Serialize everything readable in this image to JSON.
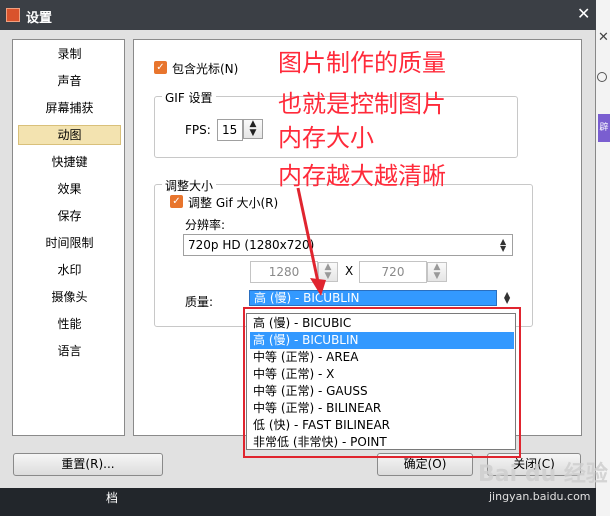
{
  "window": {
    "title": "设置",
    "close_glyph": "✕"
  },
  "sidebar": {
    "items": [
      {
        "label": "录制"
      },
      {
        "label": "声音"
      },
      {
        "label": "屏幕捕获"
      },
      {
        "label": "动图"
      },
      {
        "label": "快捷键"
      },
      {
        "label": "效果"
      },
      {
        "label": "保存"
      },
      {
        "label": "时间限制"
      },
      {
        "label": "水印"
      },
      {
        "label": "摄像头"
      },
      {
        "label": "性能"
      },
      {
        "label": "语言"
      }
    ],
    "active": "动图"
  },
  "panel": {
    "include_cursor": {
      "label": "包含光标(N)",
      "checked": true
    },
    "gif_group": {
      "legend": "GIF 设置",
      "fps_label": "FPS:",
      "fps_value": "15"
    },
    "resize_group": {
      "legend": "调整大小",
      "resize_checkbox": {
        "label": "调整 Gif 大小(R)",
        "checked": true
      },
      "resolution_label": "分辨率:",
      "resolution_value": "720p HD (1280x720)",
      "width_value": "1280",
      "x_label": "X",
      "height_value": "720",
      "quality_label": "质量:",
      "quality_value": "高 (慢) - BICUBLIN"
    }
  },
  "quality_options": [
    "高 (慢) - BICUBIC",
    "高 (慢) - BICUBLIN",
    "中等 (正常) - AREA",
    "中等 (正常) - X",
    "中等 (正常) - GAUSS",
    "中等 (正常) - BILINEAR",
    "低 (快) - FAST BILINEAR",
    "非常低 (非常快) - POINT"
  ],
  "quality_selected_index": 1,
  "annotation": {
    "lines": [
      "图片制作的质量",
      "也就是控制图片",
      "内存大小",
      "内存越大越清晰"
    ],
    "color": "#ff2a3a"
  },
  "buttons": {
    "reset": "重置(R)...",
    "ok": "确定(O)",
    "close": "关闭(C)"
  },
  "background": {
    "taskbar_text": "档",
    "watermark": "Bai du 经验",
    "watermark_url": "jingyan.baidu.com"
  }
}
